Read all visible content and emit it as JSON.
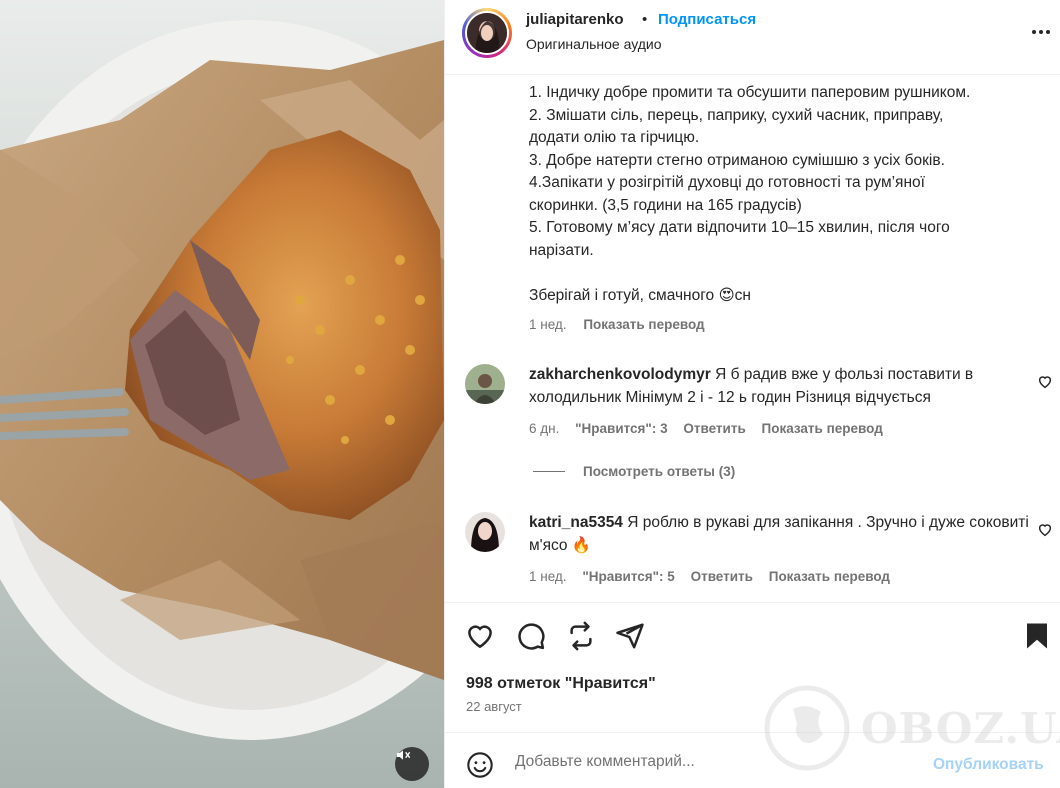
{
  "post": {
    "username": "juliapitarenko",
    "separator": "•",
    "follow_label": "Подписаться",
    "audio": "Оригинальное аудио"
  },
  "caption": {
    "lines": [
      "1. Індичку добре промити та обсушити паперовим рушником.",
      "2. Змішати сіль, перець, паприку, сухий часник, приправу,",
      "додати олію та гірчицю.",
      "3. Добре натерти стегно отриманою сумішшю з усіх боків.",
      "4.Запікати у розігрітій духовці до готовності та рум’яної",
      "скоринки. (3,5 години на 165 градусів)",
      "5. Готовому м’ясу дати відпочити 10–15 хвилин, після чого",
      "нарізати."
    ],
    "closing": "Зберігай і готуй, смачного 😍сн",
    "time": "1 нед.",
    "translate": "Показать перевод"
  },
  "comments": [
    {
      "username": "zakharchenkovolodymyr",
      "text": "Я б радив вже у фользі поставити в холодильник Мінімум 2 і - 12 ь годин Різниця відчується",
      "time": "6 дн.",
      "likes": "\"Нравится\": 3",
      "reply": "Ответить",
      "translate": "Показать перевод"
    },
    {
      "username": "katri_na5354",
      "text": "Я роблю в рукаві для запікання . Зручно і дуже соковиті м'ясо 🔥",
      "time": "1 нед.",
      "likes": "\"Нравится\": 5",
      "reply": "Ответить",
      "translate": "Показать перевод"
    }
  ],
  "view_replies": "Посмотреть ответы (3)",
  "stats": {
    "likes": "998 отметок \"Нравится\"",
    "date": "22 август"
  },
  "composer": {
    "placeholder": "Добавьте комментарий...",
    "publish": "Опубликовать"
  },
  "watermark": "OBOZ.UA",
  "icons": {
    "more": "more-options-icon",
    "like": "heart-icon",
    "comment": "comment-icon",
    "repost": "repost-icon",
    "share": "send-icon",
    "save": "bookmark-icon",
    "emoji": "emoji-icon",
    "mute": "sound-off-icon"
  }
}
